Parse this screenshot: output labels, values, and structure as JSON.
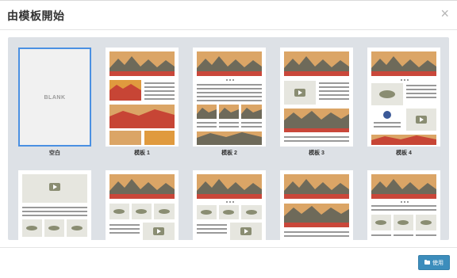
{
  "dialog": {
    "title": "由模板開始",
    "close_icon": "×"
  },
  "templates": [
    {
      "label": "空白",
      "blank_text": "BLANK",
      "selected": true
    },
    {
      "label": "模板 1",
      "selected": false
    },
    {
      "label": "模板 2",
      "selected": false
    },
    {
      "label": "模板 3",
      "selected": false
    },
    {
      "label": "模板 4",
      "selected": false
    },
    {
      "label": "",
      "selected": false
    },
    {
      "label": "",
      "selected": false
    },
    {
      "label": "",
      "selected": false
    },
    {
      "label": "",
      "selected": false
    },
    {
      "label": "",
      "selected": false
    }
  ],
  "footer": {
    "use_label": "使用",
    "use_icon": "folder-open-icon"
  },
  "colors": {
    "accent": "#3c8dbc",
    "selected_border": "#4a90e2",
    "body_bg": "#dde1e6"
  }
}
